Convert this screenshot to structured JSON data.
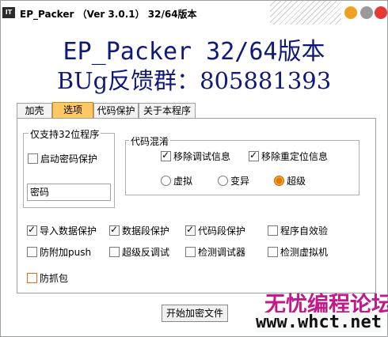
{
  "window": {
    "title": "EP_Packer  （Ver 3.0.1） 32/64版本",
    "icon_label": "IT"
  },
  "banner": {
    "line1": "EP_Packer 32/64版本",
    "line2": "BUg反馈群：805881393"
  },
  "tabs": [
    {
      "label": "加壳",
      "active": false
    },
    {
      "label": "选项",
      "active": true
    },
    {
      "label": "代码保护",
      "active": false
    },
    {
      "label": "关于本程序",
      "active": false
    }
  ],
  "group32": {
    "title": "仅支持32位程序",
    "enable_password": {
      "label": "启动密码保护",
      "checked": false
    },
    "password": {
      "value": "密码"
    }
  },
  "obfuscation": {
    "title": "代码混淆",
    "remove_debug": {
      "label": "移除调试信息",
      "checked": true
    },
    "remove_reloc": {
      "label": "移除重定位信息",
      "checked": true
    },
    "radios": [
      {
        "label": "虚拟",
        "selected": false
      },
      {
        "label": "变异",
        "selected": false
      },
      {
        "label": "超级",
        "selected": true
      }
    ]
  },
  "options": {
    "row1": [
      {
        "label": "导入数据保护",
        "checked": true
      },
      {
        "label": "数据段保护",
        "checked": true
      },
      {
        "label": "代码段保护",
        "checked": true
      },
      {
        "label": "程序自效验",
        "checked": false
      }
    ],
    "row2": [
      {
        "label": "防附加push",
        "checked": false
      },
      {
        "label": "超级反调试",
        "checked": false
      },
      {
        "label": "检测调试器",
        "checked": false
      },
      {
        "label": "检测虚拟机",
        "checked": false
      }
    ],
    "row3": [
      {
        "label": "防抓包",
        "checked": false
      }
    ]
  },
  "actions": {
    "start_label": "开始加密文件"
  },
  "watermark": {
    "line1": "无忧编程论坛",
    "line2": "www.whct.net"
  },
  "colors": {
    "banner": "#101878",
    "tab_active": "#ffc862",
    "watermark": "#c21a8a"
  }
}
